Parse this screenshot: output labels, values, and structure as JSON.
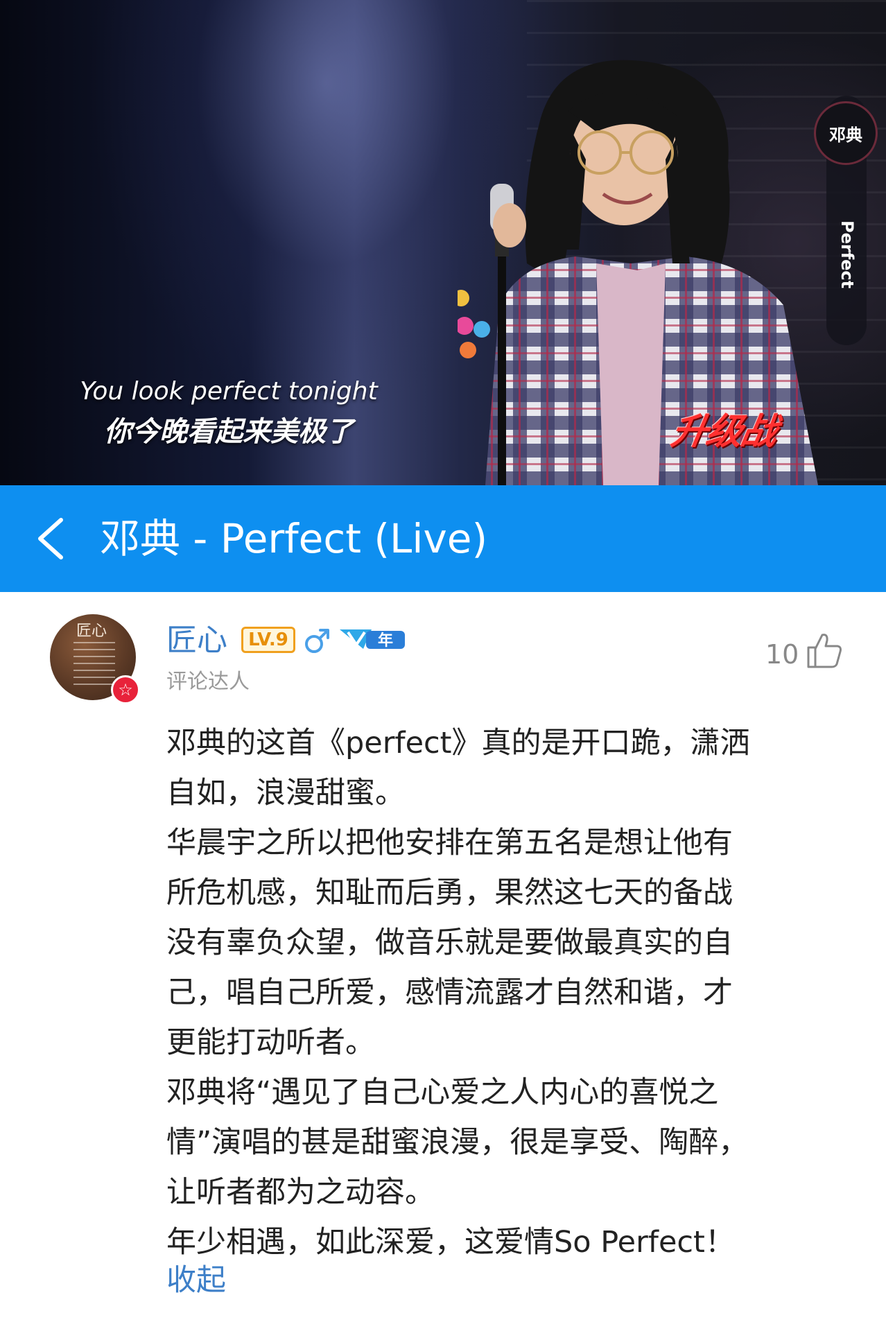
{
  "video": {
    "subtitle_en": "You look perfect tonight",
    "subtitle_zh": "你今晚看起来美极了",
    "show_logo": "升级战",
    "artist_badge": "邓典",
    "song_tag": "Perfect"
  },
  "header": {
    "title": "邓典 - Perfect (Live)",
    "back_icon": "chevron-left-icon"
  },
  "comment": {
    "username": "匠心",
    "level": "LV.9",
    "gender_icon": "male-icon",
    "vip_label": "年",
    "user_title": "评论达人",
    "like_count": "10",
    "like_icon": "thumbs-up-icon",
    "lines": [
      "邓典的这首《perfect》真的是开口跪，潇洒",
      "自如，浪漫甜蜜。",
      "华晨宇之所以把他安排在第五名是想让他有",
      "所危机感，知耻而后勇，果然这七天的备战",
      "没有辜负众望，做音乐就是要做最真实的自",
      "己，唱自己所爱，感情流露才自然和谐，才",
      "更能打动听者。",
      "邓典将“遇见了自己心爱之人内心的喜悦之",
      "情”演唱的甚是甜蜜浪漫，很是享受、陶醉，",
      "让听者都为之动容。",
      "年少相遇，如此深爱，这爱情So Perfect！"
    ],
    "collapse_label": "收起",
    "avatar_text": "匠心",
    "accent_color": "#3d7fc8"
  }
}
